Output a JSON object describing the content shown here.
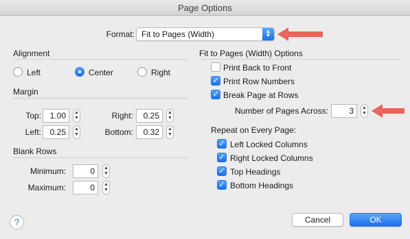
{
  "window": {
    "title": "Page Options"
  },
  "format": {
    "label": "Format:",
    "value": "Fit to Pages (Width)"
  },
  "alignment": {
    "title": "Alignment",
    "options": [
      "Left",
      "Center",
      "Right"
    ],
    "selected": "Center"
  },
  "margin": {
    "title": "Margin",
    "top_label": "Top:",
    "top": "1.00",
    "left_label": "Left:",
    "left": "0.25",
    "right_label": "Right:",
    "right": "0.25",
    "bottom_label": "Bottom:",
    "bottom": "0.32"
  },
  "blank_rows": {
    "title": "Blank Rows",
    "min_label": "Minimum:",
    "min": "0",
    "max_label": "Maximum:",
    "max": "0"
  },
  "fit_options": {
    "title": "Fit to Pages (Width) Options",
    "print_back_to_front": "Print Back to Front",
    "print_row_numbers": "Print Row Numbers",
    "break_page_at_rows": "Break Page at Rows",
    "pages_across_label": "Number of Pages Across:",
    "pages_across": "3"
  },
  "repeat": {
    "title": "Repeat on Every Page:",
    "left_locked": "Left Locked Columns",
    "right_locked": "Right Locked Columns",
    "top_headings": "Top Headings",
    "bottom_headings": "Bottom Headings"
  },
  "buttons": {
    "help": "?",
    "cancel": "Cancel",
    "ok": "OK"
  },
  "colors": {
    "accent": "#1a70ef",
    "annotation_arrow": "#e8665b"
  }
}
